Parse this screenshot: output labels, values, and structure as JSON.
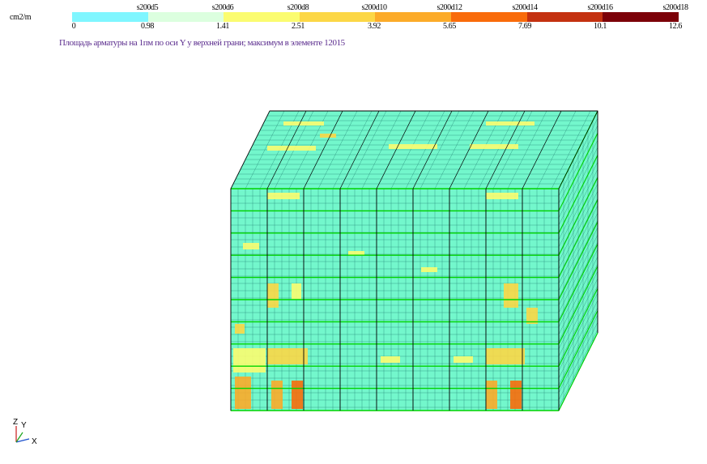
{
  "unit_label": "cm2/m",
  "legend": {
    "top_labels": [
      "s200d5",
      "s200d6",
      "s200d8",
      "s200d10",
      "s200d12",
      "s200d14",
      "s200d16",
      "s200d18"
    ],
    "bottom_labels": [
      "0",
      "0.98",
      "1.41",
      "2.51",
      "3.92",
      "5.65",
      "7.69",
      "10.1",
      "12.6"
    ],
    "colors": [
      "#7ff6ff",
      "#dcffdf",
      "#fbfc70",
      "#fcd746",
      "#fcab29",
      "#f96b0a",
      "#c43110",
      "#7c0008"
    ]
  },
  "caption": "Площадь арматуры на 1пм по оси Y у верхней грани; максимум в элементе 12015",
  "model_colors": {
    "mesh": "#73f7cc",
    "grid_line": "#1f7f70",
    "frame_line": "#00d400",
    "edge": "#000000"
  },
  "axes": {
    "z": "Z",
    "y": "Y",
    "x": "X"
  }
}
